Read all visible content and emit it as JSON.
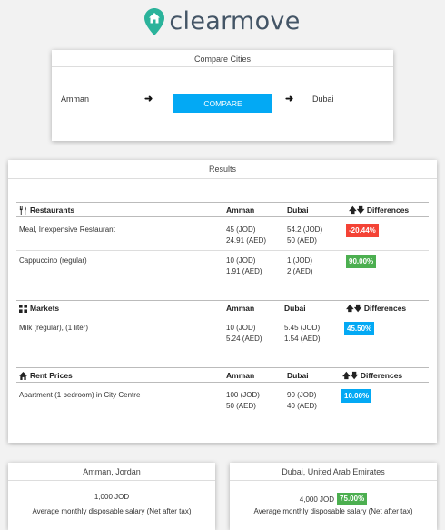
{
  "brand": {
    "name": "clearmove",
    "color": "#2bb39b",
    "text_color": "#445566"
  },
  "compare": {
    "title": "Compare Cities",
    "from_city": "Amman",
    "to_city": "Dubai",
    "button_label": "COMPARE",
    "button_color": "#03a9f4"
  },
  "results": {
    "title": "Results",
    "sections": [
      {
        "name": "Restaurants",
        "icon": "utensils-icon",
        "col_from": "Amman",
        "col_to": "Dubai",
        "col_diff": "Differences",
        "items": [
          {
            "label": "Meal, Inexpensive Restaurant",
            "from_local": "45 (JOD)",
            "from_aed": "24.91 (AED)",
            "to_local": "54.2 (JOD)",
            "to_aed": "50 (AED)",
            "diff": "-20.44%"
          },
          {
            "label": "Cappuccino (regular)",
            "from_local": "10 (JOD)",
            "from_aed": "1.91 (AED)",
            "to_local": "1 (JOD)",
            "to_aed": "2 (AED)",
            "diff": "90.00%"
          }
        ]
      },
      {
        "name": "Markets",
        "icon": "grid-icon",
        "col_from": "Amman",
        "col_to": "Dubai",
        "col_diff": "Differences",
        "items": [
          {
            "label": "Milk (regular), (1 liter)",
            "from_local": "10 (JOD)",
            "from_aed": "5.24 (AED)",
            "to_local": "5.45 (JOD)",
            "to_aed": "1.54 (AED)",
            "diff": "45.50%"
          }
        ]
      },
      {
        "name": "Rent Prices",
        "icon": "home-icon",
        "col_from": "Amman",
        "col_to": "Dubai",
        "col_diff": "Differences",
        "items": [
          {
            "label": "Apartment (1 bedroom) in City Centre",
            "from_local": "100 (JOD)",
            "from_aed": "50 (AED)",
            "to_local": "90 (JOD)",
            "to_aed": "40 (AED)",
            "diff": "10.00%"
          }
        ]
      }
    ]
  },
  "summary": {
    "from": {
      "title": "Amman, Jordan",
      "salary": "1,000 JOD",
      "caption": "Average monthly disposable salary (Net after tax)"
    },
    "to": {
      "title": "Dubai, United Arab Emirates",
      "salary": "4,000 JOD",
      "badge": "75.00%",
      "caption": "Average monthly disposable salary (Net after tax)"
    }
  },
  "colors": {
    "negative": "#f44336",
    "positive": "#4caf50",
    "neutral": "#03a9f4"
  }
}
